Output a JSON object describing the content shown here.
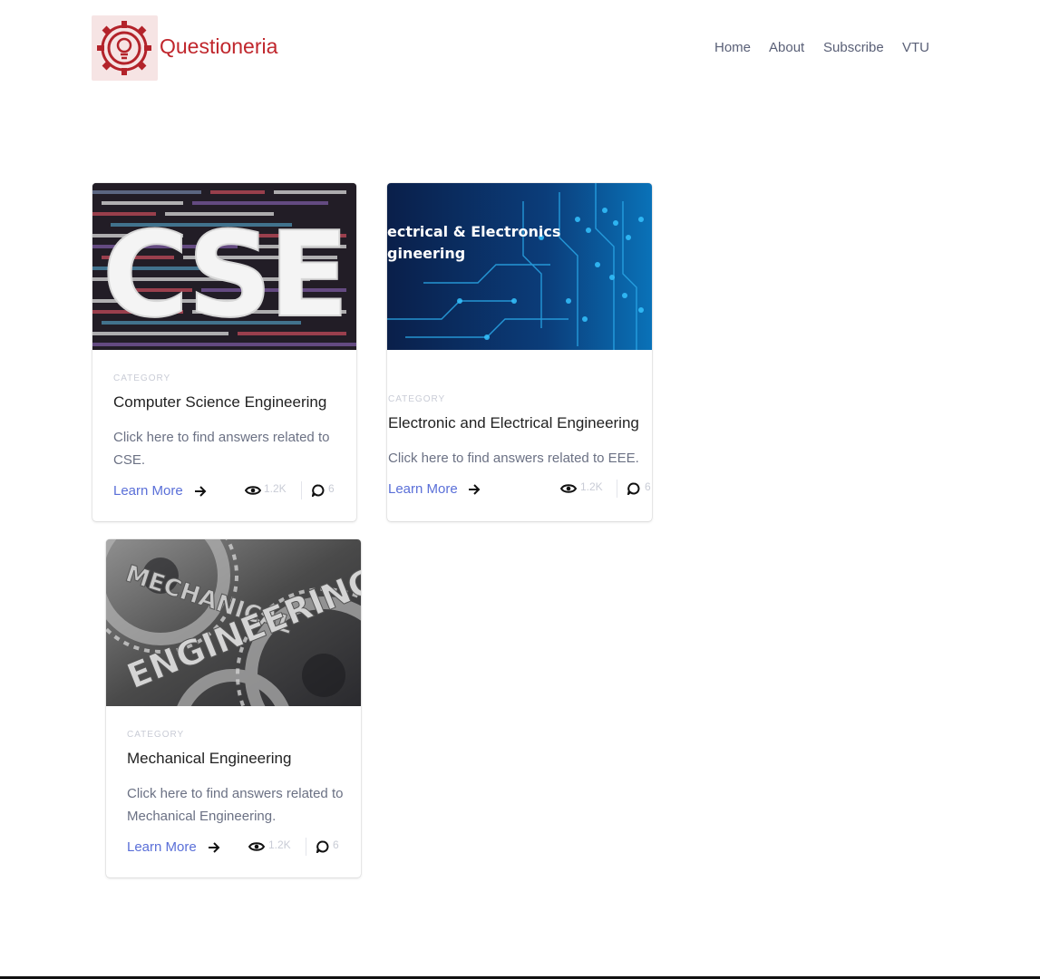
{
  "header": {
    "brand": "Questioneria",
    "nav": [
      "Home",
      "About",
      "Subscribe",
      "VTU"
    ]
  },
  "cards": [
    {
      "image_text": "CSE",
      "category": "CATEGORY",
      "title": "Computer Science Engineering",
      "description": "Click here to find answers related to CSE.",
      "link": "Learn More",
      "views": "1.2K",
      "comments": "6"
    },
    {
      "image_text": [
        "ectrical & Electronics",
        "gineering"
      ],
      "category": "CATEGORY",
      "title": "Electronic and Electrical Engineering",
      "description": "Click here to find answers related to EEE.",
      "link": "Learn More",
      "views": "1.2K",
      "comments": "6"
    },
    {
      "image_text": [
        "MECHANICAL",
        "ENGINEERING"
      ],
      "category": "CATEGORY",
      "title": "Mechanical Engineering",
      "description": "Click here to find answers related to Mechanical Engineering.",
      "link": "Learn More",
      "views": "1.2K",
      "comments": "6"
    }
  ],
  "colors": {
    "brand": "#c0262c",
    "link": "#5a6fd8",
    "nav": "#5a6077",
    "muted": "#c9ccd6"
  }
}
